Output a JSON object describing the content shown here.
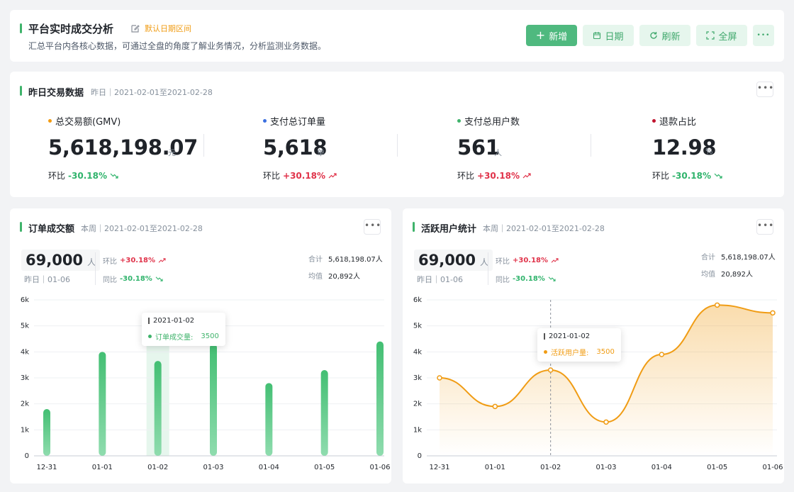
{
  "header": {
    "title": "平台实时成交分析",
    "date_range_link": "默认日期区间",
    "subtitle": "汇总平台内各核心数据，可通过全盘的角度了解业务情况，分析监测业务数据。",
    "buttons": {
      "add": "新增",
      "date": "日期",
      "refresh": "刷新",
      "fullscreen": "全屏",
      "more": "•••"
    }
  },
  "yesterday": {
    "title": "昨日交易数据",
    "meta": "昨日｜2021-02-01至2021-02-28",
    "kpis": [
      {
        "label": "总交易额(GMV)",
        "value": "5,618,198.07",
        "unit": "元",
        "ratio_label": "环比",
        "ratio": "-30.18%",
        "trend": "down",
        "dot": "#f39c12"
      },
      {
        "label": "支付总订单量",
        "value": "5,618",
        "unit": "单",
        "ratio_label": "环比",
        "ratio": "+30.18%",
        "trend": "up",
        "dot": "#3b6fe0"
      },
      {
        "label": "支付总用户数",
        "value": "561",
        "unit": "人",
        "ratio_label": "环比",
        "ratio": "+30.18%",
        "trend": "up",
        "dot": "#3fb36b"
      },
      {
        "label": "退款占比",
        "value": "12.98",
        "unit": "%",
        "ratio_label": "环比",
        "ratio": "-30.18%",
        "trend": "down",
        "dot": "#c0132e"
      }
    ]
  },
  "orders_card": {
    "title": "订单成交额",
    "meta": "本周｜2021-02-01至2021-02-28",
    "big_value": "69,000",
    "big_unit": "人",
    "sub": "昨日｜01-06",
    "hb_label": "环比",
    "hb_value": "+30.18%",
    "tb_label": "同比",
    "tb_value": "-30.18%",
    "total_label": "合计",
    "total_value": "5,618,198.07人",
    "avg_label": "均值",
    "avg_value": "20,892人",
    "tooltip": {
      "date": "2021-01-02",
      "label": "订单成交量:",
      "value": "3500"
    }
  },
  "users_card": {
    "title": "活跃用户统计",
    "meta": "本周｜2021-02-01至2021-02-28",
    "big_value": "69,000",
    "big_unit": "人",
    "sub": "昨日｜01-06",
    "hb_label": "环比",
    "hb_value": "+30.18%",
    "tb_label": "同比",
    "tb_value": "-30.18%",
    "total_label": "合计",
    "total_value": "5,618,198.07人",
    "avg_label": "均值",
    "avg_value": "20,892人",
    "tooltip": {
      "date": "2021-01-02",
      "label": "活跃用户量:",
      "value": "3500"
    }
  },
  "colors": {
    "accent": "#3fb36b",
    "line": "#f09c14",
    "up": "#e0334a",
    "down": "#2fb36b"
  },
  "chart_data": [
    {
      "type": "bar",
      "categories": [
        "12-31",
        "01-01",
        "01-02",
        "01-03",
        "01-04",
        "01-05",
        "01-06"
      ],
      "values": [
        1800,
        4000,
        3650,
        4300,
        2800,
        3300,
        4400
      ],
      "yticks": [
        "0",
        "1k",
        "2k",
        "3k",
        "4k",
        "5k",
        "6k"
      ],
      "ylim": [
        0,
        6000
      ],
      "highlight": "01-02"
    },
    {
      "type": "area",
      "categories": [
        "12-31",
        "01-01",
        "01-02",
        "01-03",
        "01-04",
        "01-05",
        "01-06"
      ],
      "values": [
        3000,
        1900,
        3300,
        1300,
        3900,
        5800,
        5500
      ],
      "yticks": [
        "0",
        "1k",
        "2k",
        "3k",
        "4k",
        "5k",
        "6k"
      ],
      "ylim": [
        0,
        6000
      ],
      "highlight": "01-02"
    }
  ]
}
